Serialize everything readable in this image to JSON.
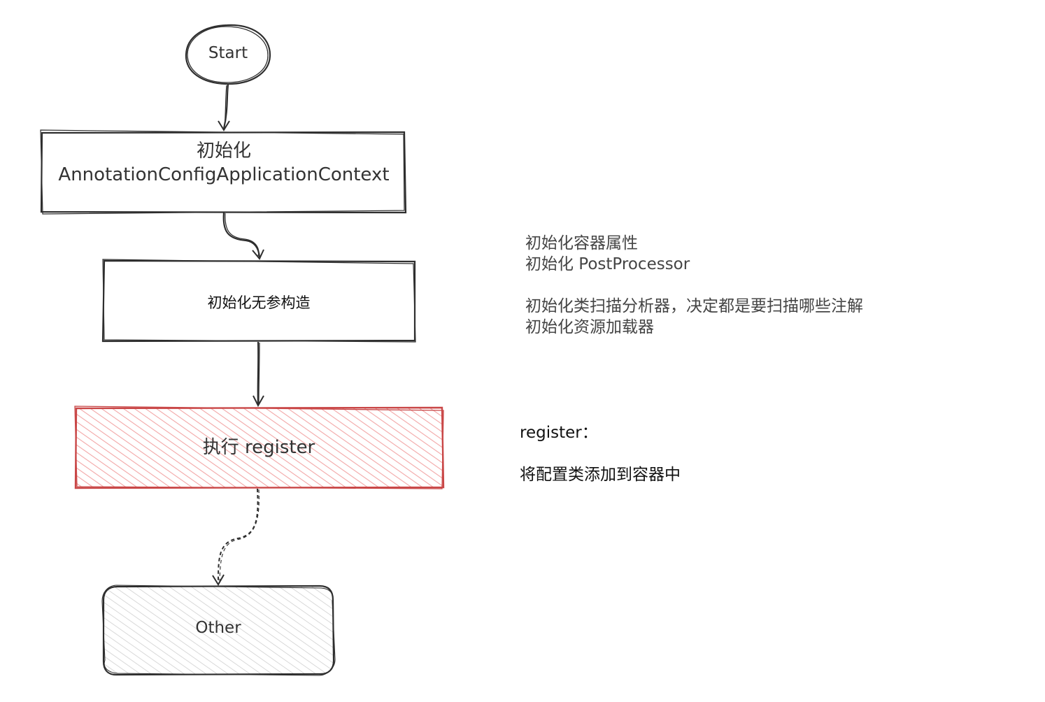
{
  "colors": {
    "stroke": "#2e2e2e",
    "accent_red": "#c94747",
    "hatch_red": "#f2a6a6",
    "hatch_gray": "#cfcfcf",
    "text": "#333333"
  },
  "nodes": {
    "start": {
      "label": "Start"
    },
    "init_context": {
      "line1": "初始化",
      "line2": "AnnotationConfigApplicationContext"
    },
    "init_noarg": {
      "label": "初始化无参构造"
    },
    "exec_register": {
      "label": "执行 register"
    },
    "other": {
      "label": "Other"
    }
  },
  "notes": {
    "init_note": {
      "line1": "初始化容器属性",
      "line2": "初始化 PostProcessor",
      "line3": "初始化类扫描分析器，决定都是要扫描哪些注解",
      "line4": "初始化资源加载器"
    },
    "register_note": {
      "title": "register：",
      "body": "将配置类添加到容器中"
    }
  }
}
